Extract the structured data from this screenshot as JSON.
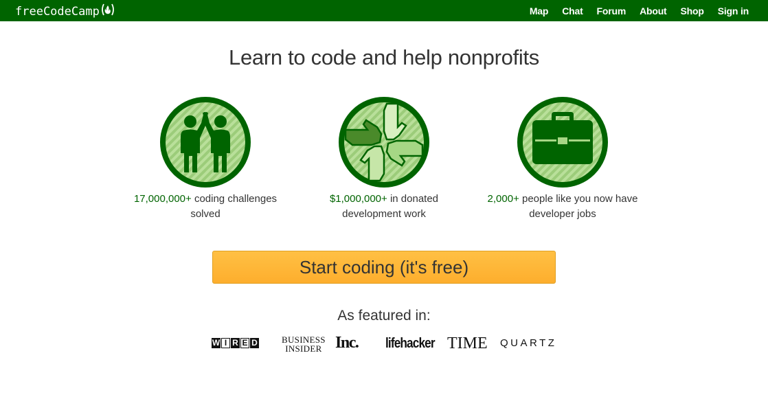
{
  "nav": {
    "brand": "freeCodeCamp",
    "brand_icon": "fire-icon",
    "links": [
      "Map",
      "Chat",
      "Forum",
      "About",
      "Shop",
      "Sign in"
    ]
  },
  "headline": "Learn to code and help nonprofits",
  "features": [
    {
      "icon": "high-five-icon",
      "highlight": "17,000,000+",
      "text_line1": " coding challenges",
      "text_line2": "solved"
    },
    {
      "icon": "hands-icon",
      "highlight": "$1,000,000+",
      "text_line1": " in donated",
      "text_line2": "development work"
    },
    {
      "icon": "briefcase-icon",
      "highlight": "2,000+",
      "text_line1": " people like you now have",
      "text_line2": "developer jobs"
    }
  ],
  "cta_label": "Start coding (it's free)",
  "featured": {
    "title": "As featured in:",
    "logos": {
      "wired": [
        "W",
        "I",
        "R",
        "E",
        "D"
      ],
      "business_insider_line1": "BUSINESS",
      "business_insider_line2": "INSIDER",
      "inc": "Inc.",
      "lifehacker": "lifehacker",
      "time": "TIME",
      "quartz": "QUARTZ"
    }
  },
  "colors": {
    "brand_green": "#006400",
    "light_green": "#a6d785",
    "cta_orange": "#ffb838"
  }
}
